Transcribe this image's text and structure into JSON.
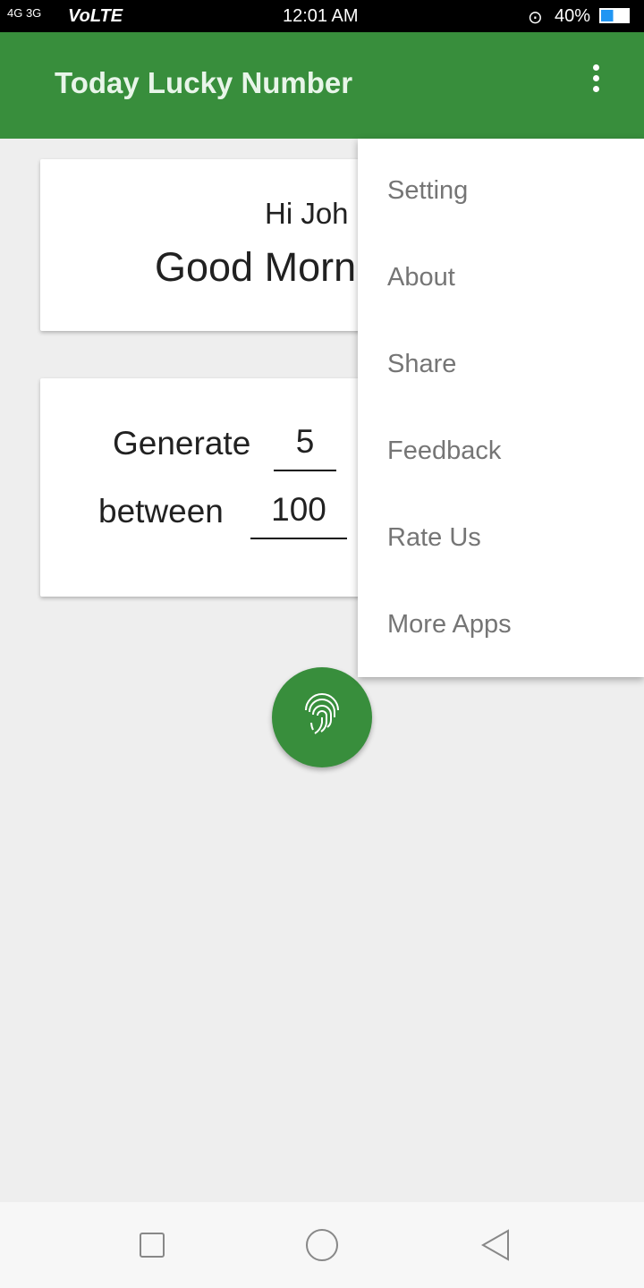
{
  "status_bar": {
    "network": "4G 3G",
    "volte": "VoLTE",
    "time": "12:01 AM",
    "battery": "40%"
  },
  "app_bar": {
    "title": "Today Lucky Number",
    "overflow_icon": "more-vert-icon"
  },
  "greeting_card": {
    "line1": "Hi Joh",
    "line2": "Good Morn"
  },
  "generate_card": {
    "label1": "Generate",
    "count_value": "5",
    "label2": "between",
    "min_value": "100"
  },
  "fab": {
    "icon": "fingerprint-icon"
  },
  "menu": {
    "items": [
      {
        "label": "Setting"
      },
      {
        "label": "About"
      },
      {
        "label": "Share"
      },
      {
        "label": "Feedback"
      },
      {
        "label": "Rate Us"
      },
      {
        "label": "More Apps"
      }
    ]
  },
  "colors": {
    "primary": "#388e3c",
    "background": "#eeeeee"
  }
}
